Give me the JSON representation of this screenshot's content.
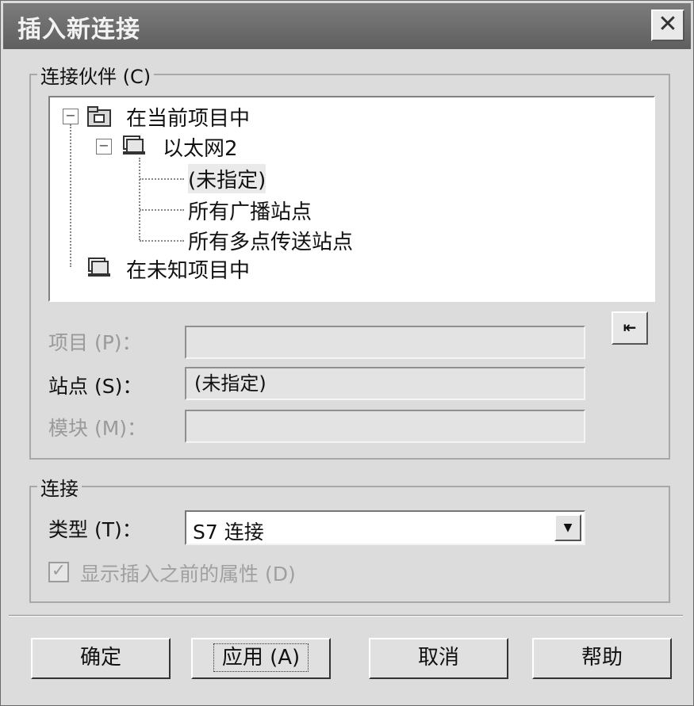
{
  "window": {
    "title": "插入新连接",
    "close_symbol": "✕"
  },
  "partner_group": {
    "title": "连接伙伴 (C)",
    "tree": {
      "root": "在当前项目中",
      "network": "以太网2",
      "children": [
        "(未指定)",
        "所有广播站点",
        "所有多点传送站点"
      ],
      "unknown": "在未知项目中",
      "expand_symbol": "−"
    },
    "project_label": "项目 (P)：",
    "project_value": "",
    "station_label": "站点 (S)：",
    "station_value": "(未指定)",
    "module_label": "模块 (M)：",
    "module_value": "",
    "side_button_label": "⇤"
  },
  "connection_group": {
    "title": "连接",
    "type_label": "类型 (T)：",
    "type_value": "S7 连接",
    "dropdown_arrow": "▼",
    "checkbox_label": "显示插入之前的属性 (D)",
    "checkbox_checked": true,
    "checkbox_enabled": false
  },
  "buttons": {
    "ok": "确定",
    "apply": "应用 (A)",
    "cancel": "取消",
    "help": "帮助"
  },
  "icons": {
    "folder": "project-folder-icon",
    "station": "station-icon",
    "close": "close-icon"
  }
}
